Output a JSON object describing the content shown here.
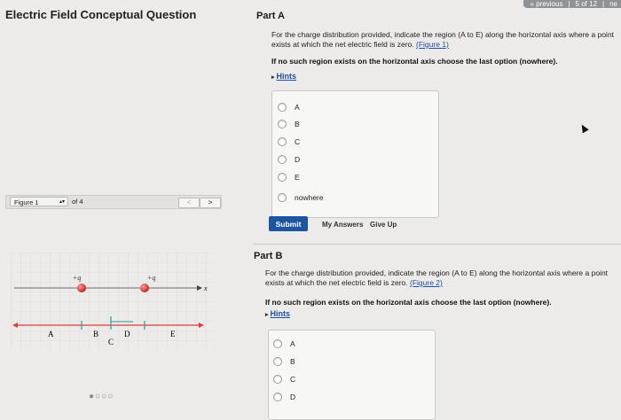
{
  "top_nav": {
    "previous": "« previous",
    "position": "5 of 12",
    "next": "ne"
  },
  "app_title": "Electric Field Conceptual Question",
  "part_a": {
    "title": "Part A",
    "question": "For the charge distribution provided, indicate the region (A to E) along the horizontal axis where a point exists at which the net electric field is zero.",
    "figure_link": "(Figure 1)",
    "instruction": "If no such region exists on the horizontal axis choose the last option (nowhere).",
    "hints": "Hints",
    "options": [
      "A",
      "B",
      "C",
      "D",
      "E",
      "nowhere"
    ],
    "submit": "Submit",
    "my_answers": "My Answers",
    "give_up": "Give Up"
  },
  "part_b": {
    "title": "Part B",
    "question": "For the charge distribution provided, indicate the region (A to E) along the horizontal axis where a point exists at which the net electric field is zero.",
    "figure_link": "(Figure 2)",
    "instruction": "If no such region exists on the horizontal axis choose the last option (nowhere).",
    "hints": "Hints",
    "options": [
      "A",
      "B",
      "C",
      "D"
    ]
  },
  "figure_panel": {
    "select_value": "Figure 1",
    "of_label": "of 4",
    "prev": "<",
    "next": ">",
    "charge1": "+q",
    "charge2": "+q",
    "axis_label": "x",
    "regions": [
      "A",
      "B",
      "C",
      "D",
      "E"
    ],
    "pager_dots": "●○○○"
  },
  "colors": {
    "accent": "#1e55a3",
    "charge": "#d83c3c",
    "axis_red": "#e03a3a",
    "axis_teal": "#2a9aa0"
  }
}
